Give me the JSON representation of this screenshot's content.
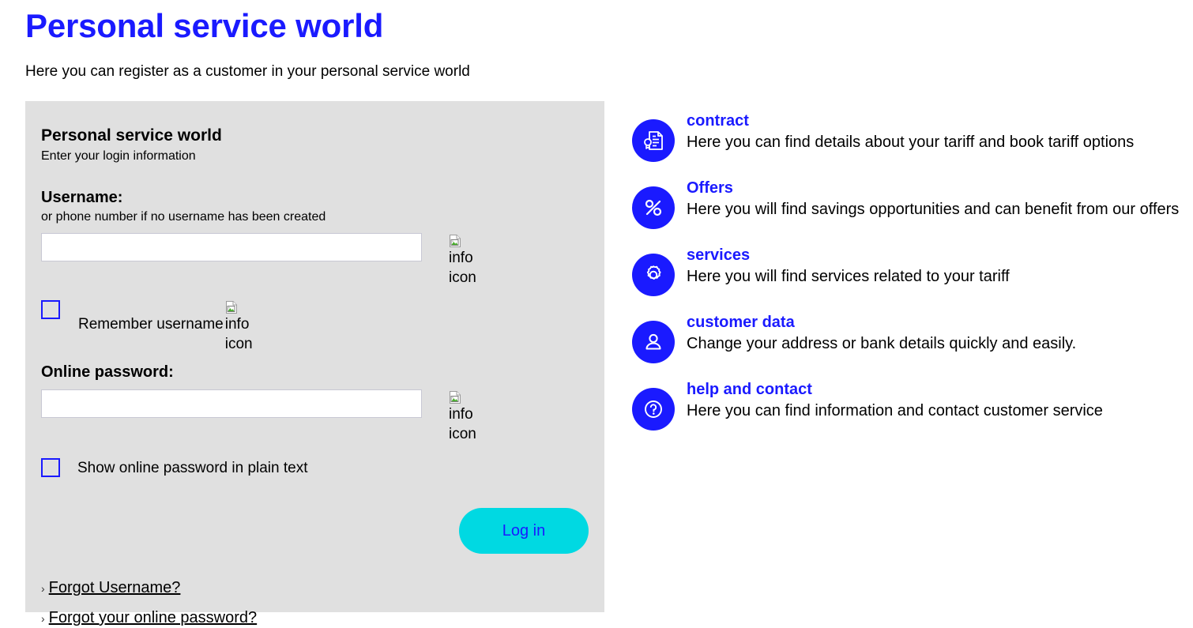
{
  "page": {
    "title": "Personal service world",
    "subtitle": "Here you can register as a customer in your personal service world"
  },
  "login": {
    "panel_title": "Personal service world",
    "panel_subtitle": "Enter your login information",
    "username_label": "Username:",
    "username_hint": "or phone number if no username has been created",
    "username_value": "",
    "username_info_alt": "info icon",
    "remember_label": "Remember username",
    "remember_info_alt": "info icon",
    "remember_checked": false,
    "password_label": "Online password:",
    "password_value": "",
    "password_info_alt": "info icon",
    "show_password_label": "Show online password in plain text",
    "show_password_checked": false,
    "submit_label": "Log in",
    "link_marker": "›",
    "forgot_username": "Forgot Username?",
    "forgot_password": "Forgot your online password?"
  },
  "info": {
    "items": [
      {
        "icon": "contract-document-icon",
        "title": "contract",
        "desc": "Here you can find details about your tariff and book tariff options"
      },
      {
        "icon": "percent-icon",
        "title": "Offers",
        "desc": "Here you will find savings opportunities and can benefit from our offers"
      },
      {
        "icon": "gear-icon",
        "title": "services",
        "desc": "Here you will find services related to your tariff"
      },
      {
        "icon": "person-icon",
        "title": "customer data",
        "desc": "Change your address or bank details quickly and easily."
      },
      {
        "icon": "question-mark-icon",
        "title": "help and contact",
        "desc": "Here you can find information and contact customer service"
      }
    ]
  },
  "colors": {
    "brand_blue": "#1a1aff",
    "panel_gray": "#e0e0e0",
    "button_cyan": "#00d9e2"
  }
}
